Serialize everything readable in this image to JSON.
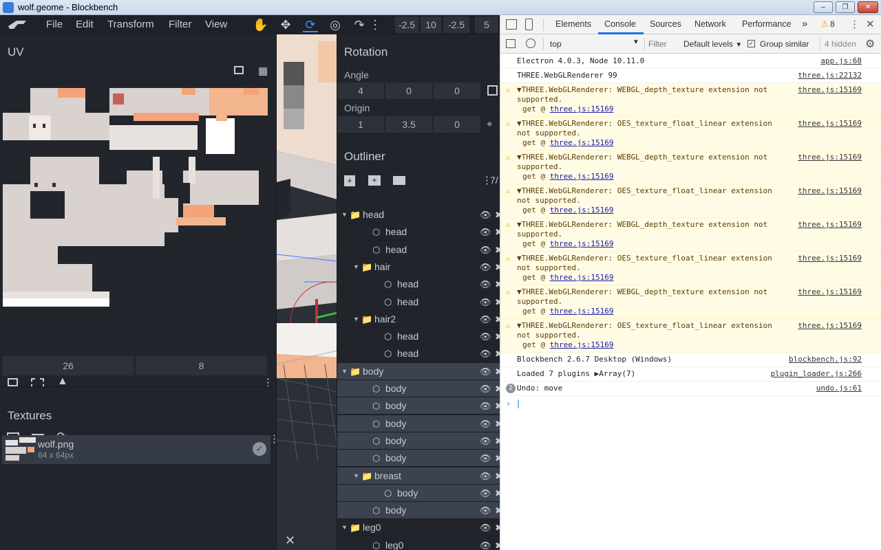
{
  "window": {
    "title": "wolf.geome - Blockbench"
  },
  "menu": {
    "items": [
      "File",
      "Edit",
      "Transform",
      "Filter",
      "View"
    ]
  },
  "toolbar": {
    "values": [
      "-2.5",
      "10",
      "-2.5",
      "5"
    ]
  },
  "uv": {
    "title": "UV",
    "size": [
      "26",
      "8"
    ]
  },
  "textures": {
    "title": "Textures",
    "item_name": "wolf.png",
    "item_size": "64 x 64px"
  },
  "rotation": {
    "title": "Rotation",
    "angle_label": "Angle",
    "angle": [
      "4",
      "0",
      "0"
    ],
    "origin_label": "Origin",
    "origin": [
      "1",
      "3.5",
      "0"
    ]
  },
  "outliner": {
    "title": "Outliner",
    "count": "7/",
    "rows": [
      {
        "name": "head",
        "type": "group",
        "depth": 0,
        "selected": false
      },
      {
        "name": "head",
        "type": "cube",
        "depth": 1,
        "selected": false
      },
      {
        "name": "head",
        "type": "cube",
        "depth": 1,
        "selected": false
      },
      {
        "name": "hair",
        "type": "group",
        "depth": 1,
        "selected": false
      },
      {
        "name": "head",
        "type": "cube",
        "depth": 2,
        "selected": false
      },
      {
        "name": "head",
        "type": "cube",
        "depth": 2,
        "selected": false
      },
      {
        "name": "hair2",
        "type": "group",
        "depth": 1,
        "selected": false
      },
      {
        "name": "head",
        "type": "cube",
        "depth": 2,
        "selected": false
      },
      {
        "name": "head",
        "type": "cube",
        "depth": 2,
        "selected": false
      },
      {
        "name": "body",
        "type": "group",
        "depth": 0,
        "selected": true
      },
      {
        "name": "body",
        "type": "cube",
        "depth": 1,
        "selected": true
      },
      {
        "name": "body",
        "type": "cube",
        "depth": 1,
        "selected": true
      },
      {
        "name": "body",
        "type": "cube",
        "depth": 1,
        "selected": true
      },
      {
        "name": "body",
        "type": "cube",
        "depth": 1,
        "selected": true
      },
      {
        "name": "body",
        "type": "cube",
        "depth": 1,
        "selected": true
      },
      {
        "name": "breast",
        "type": "group",
        "depth": 1,
        "selected": true
      },
      {
        "name": "body",
        "type": "cube",
        "depth": 2,
        "selected": true
      },
      {
        "name": "body",
        "type": "cube",
        "depth": 1,
        "selected": true
      },
      {
        "name": "leg0",
        "type": "group",
        "depth": 0,
        "selected": false
      },
      {
        "name": "leg0",
        "type": "cube",
        "depth": 1,
        "selected": false
      }
    ]
  },
  "devtools": {
    "tabs": [
      "Elements",
      "Console",
      "Sources",
      "Network",
      "Performance"
    ],
    "active_tab": "Console",
    "more": "»",
    "warnings_count": "8",
    "context": "top",
    "filter_placeholder": "Filter",
    "levels": "Default levels",
    "group_similar": "Group similar",
    "hidden": "4 hidden",
    "logs": [
      {
        "type": "info",
        "text": "Electron 4.0.3, Node 10.11.0",
        "src": "app.js:68"
      },
      {
        "type": "info",
        "text": "THREE.WebGLRenderer 99",
        "src": "three.js:22132"
      },
      {
        "type": "warn",
        "text": "▼THREE.WebGLRenderer: WEBGL_depth_texture extension not supported.",
        "src": "three.js:15169",
        "sub_prefix": "get @ ",
        "sub_link": "three.js:15169"
      },
      {
        "type": "warn",
        "text": "▼THREE.WebGLRenderer: OES_texture_float_linear extension not supported.",
        "src": "three.js:15169",
        "sub_prefix": "get @ ",
        "sub_link": "three.js:15169"
      },
      {
        "type": "warn",
        "text": "▼THREE.WebGLRenderer: WEBGL_depth_texture extension not supported.",
        "src": "three.js:15169",
        "sub_prefix": "get @ ",
        "sub_link": "three.js:15169"
      },
      {
        "type": "warn",
        "text": "▼THREE.WebGLRenderer: OES_texture_float_linear extension not supported.",
        "src": "three.js:15169",
        "sub_prefix": "get @ ",
        "sub_link": "three.js:15169"
      },
      {
        "type": "warn",
        "text": "▼THREE.WebGLRenderer: WEBGL_depth_texture extension not supported.",
        "src": "three.js:15169",
        "sub_prefix": "get @ ",
        "sub_link": "three.js:15169"
      },
      {
        "type": "warn",
        "text": "▼THREE.WebGLRenderer: OES_texture_float_linear extension not supported.",
        "src": "three.js:15169",
        "sub_prefix": "get @ ",
        "sub_link": "three.js:15169"
      },
      {
        "type": "warn",
        "text": "▼THREE.WebGLRenderer: WEBGL_depth_texture extension not supported.",
        "src": "three.js:15169",
        "sub_prefix": "get @ ",
        "sub_link": "three.js:15169"
      },
      {
        "type": "warn",
        "text": "▼THREE.WebGLRenderer: OES_texture_float_linear extension not supported.",
        "src": "three.js:15169",
        "sub_prefix": "get @ ",
        "sub_link": "three.js:15169"
      },
      {
        "type": "info",
        "text": "Blockbench 2.6.7 Desktop (Windows)",
        "src": "blockbench.js:92"
      },
      {
        "type": "info",
        "text": "Loaded 7 plugins ▶Array(7)",
        "src": "plugin_loader.js:266"
      },
      {
        "type": "count",
        "count": "2",
        "text": "Undo: move",
        "src": "undo.js:61"
      }
    ]
  }
}
